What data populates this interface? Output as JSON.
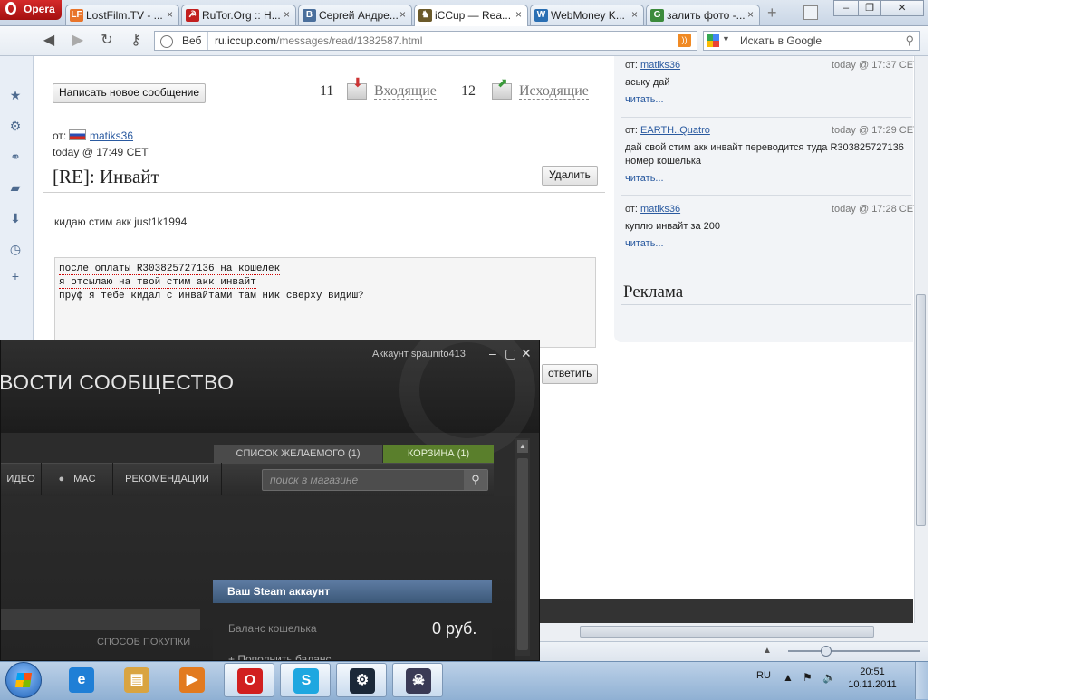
{
  "browser": {
    "menu_label": "Opera",
    "tabs": [
      {
        "favicon": "LF",
        "favicon_color": "#e8742a",
        "label": "LostFilm.TV - ...",
        "close": "×"
      },
      {
        "favicon": "☭",
        "favicon_color": "#c21f1f",
        "label": "RuTor.Org :: Н...",
        "close": "×"
      },
      {
        "favicon": "В",
        "favicon_color": "#4a6f9c",
        "label": "Сергей Андре...",
        "close": "×"
      },
      {
        "favicon": "♞",
        "favicon_color": "#6b5a2a",
        "label": "iCCup — Rea...",
        "close": "×"
      },
      {
        "favicon": "W",
        "favicon_color": "#2a6fb3",
        "label": "WebMoney K...",
        "close": "×"
      },
      {
        "favicon": "G",
        "favicon_color": "#3b8a3b",
        "label": "залить фото -...",
        "close": "×"
      }
    ],
    "active_tab_index": 3,
    "address": {
      "mode": "Веб",
      "host": "ru.iccup.com",
      "path": "/messages/read/1382587.html"
    },
    "search": {
      "placeholder": "Искать в Google"
    }
  },
  "messages": {
    "new_message_label": "Написать новое сообщение",
    "inbox_count": "11",
    "inbox_label": "Входящие",
    "outbox_count": "12",
    "outbox_label": "Исходящие",
    "from_label": "от:",
    "from_user": "matiks36",
    "date": "today @ 17:49 CET",
    "subject": "[RE]: Инвайт",
    "delete_label": "Удалить",
    "body": "кидаю стим акк just1k1994",
    "quote_lines": [
      "после оплаты R303825727136 на кошелек",
      "я отсылаю на твой стим акк инвайт",
      "пруф я тебе кидал с инвайтами там ник сверху видиш?"
    ],
    "reply_label": "ответить"
  },
  "thread": [
    {
      "from_label": "от:",
      "user": "matiks36",
      "time": "today @ 17:37 CET",
      "text": "аську дай",
      "more": "читать..."
    },
    {
      "from_label": "от:",
      "user": "EARTH..Quatro",
      "time": "today @ 17:29 CET",
      "text": "дай свой стим акк инвайт переводится туда R303825727136 номер кошелька",
      "more": "читать..."
    },
    {
      "from_label": "от:",
      "user": "matiks36",
      "time": "today @ 17:28 CET",
      "text": "куплю инвайт за 200",
      "more": "читать..."
    }
  ],
  "ads_title": "Реклама",
  "steam": {
    "account_label": "Аккаунт spaunito413",
    "nav": "ВОСТИ   СООБЩЕСТВО",
    "wishlist_label": "СПИСОК ЖЕЛАЕМОГО (1)",
    "cart_label": "КОРЗИНА (1)",
    "tabs": [
      "ИДЕО",
      "MAC",
      "РЕКОМЕНДАЦИИ"
    ],
    "search_placeholder": "поиск в магазине",
    "account_box_title": "Ваш Steam аккаунт",
    "balance_label": "Баланс кошелька",
    "balance_value": "0 руб.",
    "topup_label": "+ Пополнить баланс",
    "payment_label": "СПОСОБ ПОКУПКИ"
  },
  "taskbar": {
    "apps": [
      {
        "name": "internet-explorer",
        "glyph": "e",
        "color": "#1f7fd6",
        "active": false
      },
      {
        "name": "explorer",
        "glyph": "▤",
        "color": "#d9a441",
        "active": false
      },
      {
        "name": "media-player",
        "glyph": "▶",
        "color": "#e27a1f",
        "active": false
      },
      {
        "name": "opera",
        "glyph": "O",
        "color": "#d11f1f",
        "active": true
      },
      {
        "name": "skype",
        "glyph": "S",
        "color": "#1ea7e0",
        "active": true
      },
      {
        "name": "steam",
        "glyph": "⚙",
        "color": "#1b2838",
        "active": true
      },
      {
        "name": "warcraft",
        "glyph": "☠",
        "color": "#3a3a55",
        "active": true
      }
    ],
    "lang": "RU",
    "time": "20:51",
    "date": "10.11.2011"
  }
}
